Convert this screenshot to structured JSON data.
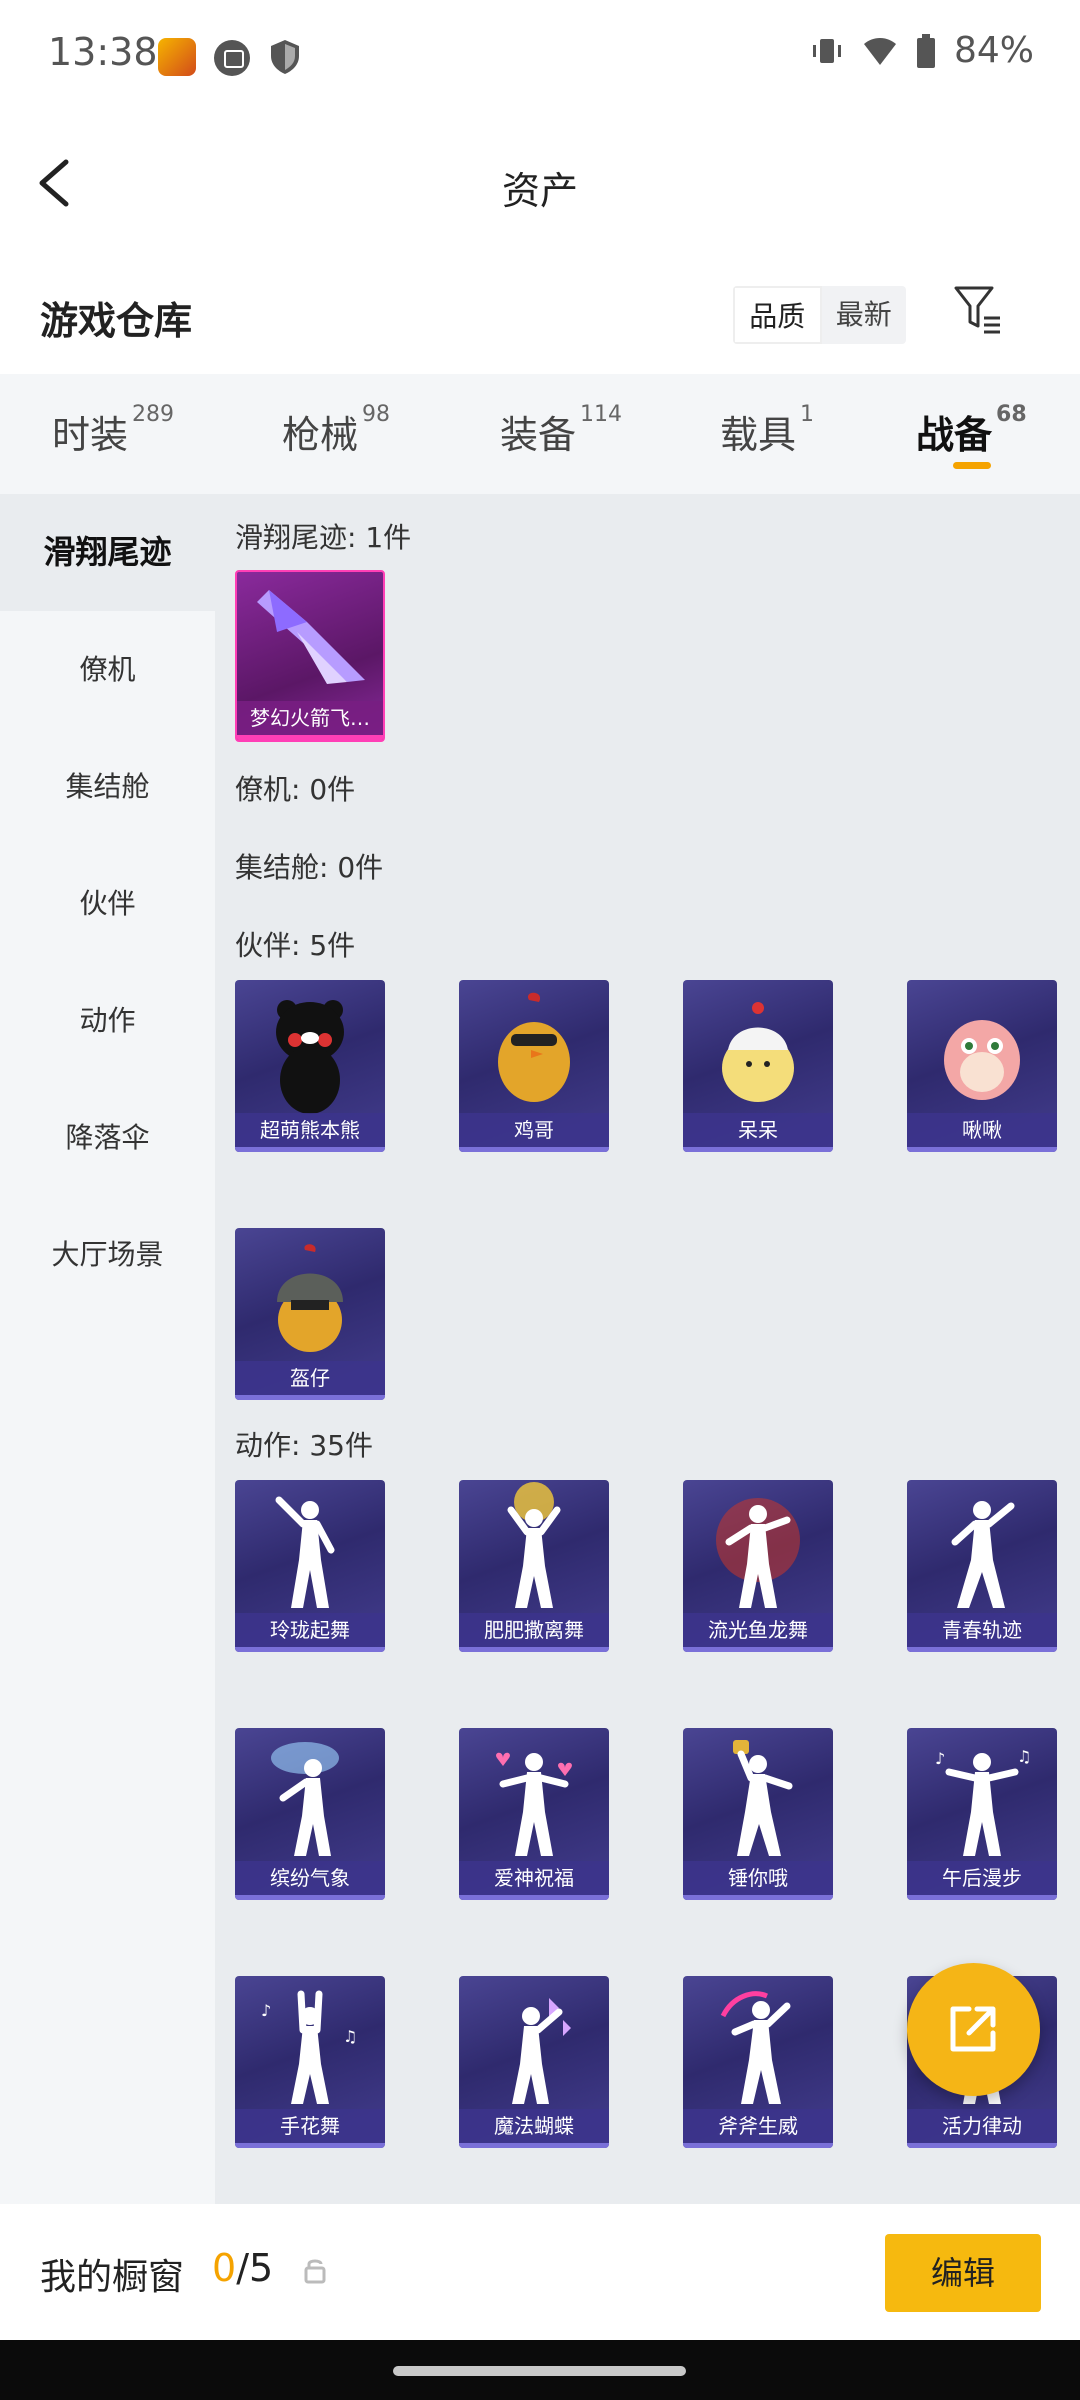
{
  "status_bar": {
    "time": "13:38",
    "battery": "84%"
  },
  "header": {
    "title": "资产"
  },
  "warehouse": {
    "title": "游戏仓库",
    "sort_quality": "品质",
    "sort_newest": "最新"
  },
  "tabs": [
    {
      "label": "时装",
      "count": "289"
    },
    {
      "label": "枪械",
      "count": "98"
    },
    {
      "label": "装备",
      "count": "114"
    },
    {
      "label": "载具",
      "count": "1"
    },
    {
      "label": "战备",
      "count": "68"
    }
  ],
  "sidebar": {
    "items": [
      "滑翔尾迹",
      "僚机",
      "集结舱",
      "伙伴",
      "动作",
      "降落伞",
      "大厅场景"
    ]
  },
  "sections": {
    "glide": {
      "label": "滑翔尾迹: 1件",
      "items": [
        "梦幻火箭飞…"
      ]
    },
    "wingman": {
      "label": "僚机: 0件"
    },
    "pod": {
      "label": "集结舱: 0件"
    },
    "partner": {
      "label": "伙伴: 5件",
      "items": [
        "超萌熊本熊",
        "鸡哥",
        "呆呆",
        "啾啾",
        "盔仔"
      ]
    },
    "emote": {
      "label": "动作: 35件",
      "items": [
        "玲珑起舞",
        "肥肥撒离舞",
        "流光鱼龙舞",
        "青春轨迹",
        "缤纷气象",
        "爱神祝福",
        "锤你哦",
        "午后漫步",
        "手花舞",
        "魔法蝴蝶",
        "斧斧生威",
        "活力律动"
      ]
    }
  },
  "bottom": {
    "showcase_label": "我的橱窗",
    "showcase_used": "0",
    "showcase_total": "/5",
    "edit_label": "编辑"
  },
  "colors": {
    "accent": "#f5a300",
    "card_purple": "#3a3580",
    "card_pink": "#ff3fb6"
  }
}
